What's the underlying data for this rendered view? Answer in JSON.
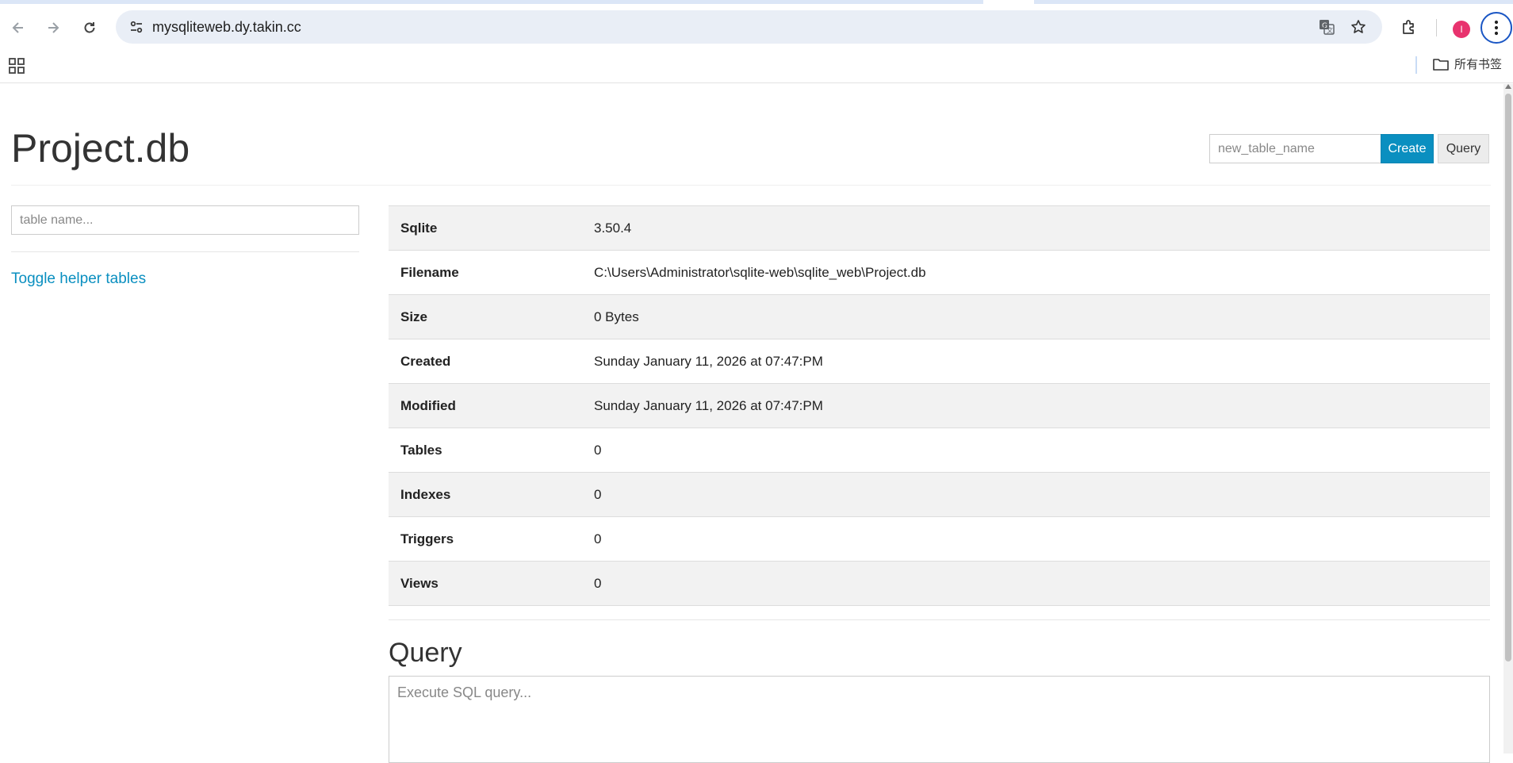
{
  "browser": {
    "url": "mysqliteweb.dy.takin.cc",
    "profile_initial": "I",
    "bookmarks_folder": "所有书签",
    "icons": [
      "back-arrow-icon",
      "forward-arrow-icon",
      "reload-icon",
      "site-info-icon",
      "translate-icon",
      "bookmark-star-icon",
      "extensions-icon",
      "apps-grid-icon",
      "folder-icon",
      "kebab-menu-icon"
    ]
  },
  "header": {
    "title": "Project.db",
    "new_table_placeholder": "new_table_name",
    "create_label": "Create",
    "query_label": "Query"
  },
  "sidebar": {
    "filter_placeholder": "table name...",
    "toggle_label": "Toggle helper tables"
  },
  "info": {
    "rows": [
      {
        "label": "Sqlite",
        "value": "3.50.4"
      },
      {
        "label": "Filename",
        "value": "C:\\Users\\Administrator\\sqlite-web\\sqlite_web\\Project.db"
      },
      {
        "label": "Size",
        "value": "0 Bytes"
      },
      {
        "label": "Created",
        "value": "Sunday January 11, 2026 at 07:47:PM"
      },
      {
        "label": "Modified",
        "value": "Sunday January 11, 2026 at 07:47:PM"
      },
      {
        "label": "Tables",
        "value": "0"
      },
      {
        "label": "Indexes",
        "value": "0"
      },
      {
        "label": "Triggers",
        "value": "0"
      },
      {
        "label": "Views",
        "value": "0"
      }
    ]
  },
  "query": {
    "heading": "Query",
    "placeholder": "Execute SQL query..."
  },
  "colors": {
    "accent": "#0a8fc0",
    "profile": "#e8336e",
    "omnibox": "#e9eef6"
  }
}
